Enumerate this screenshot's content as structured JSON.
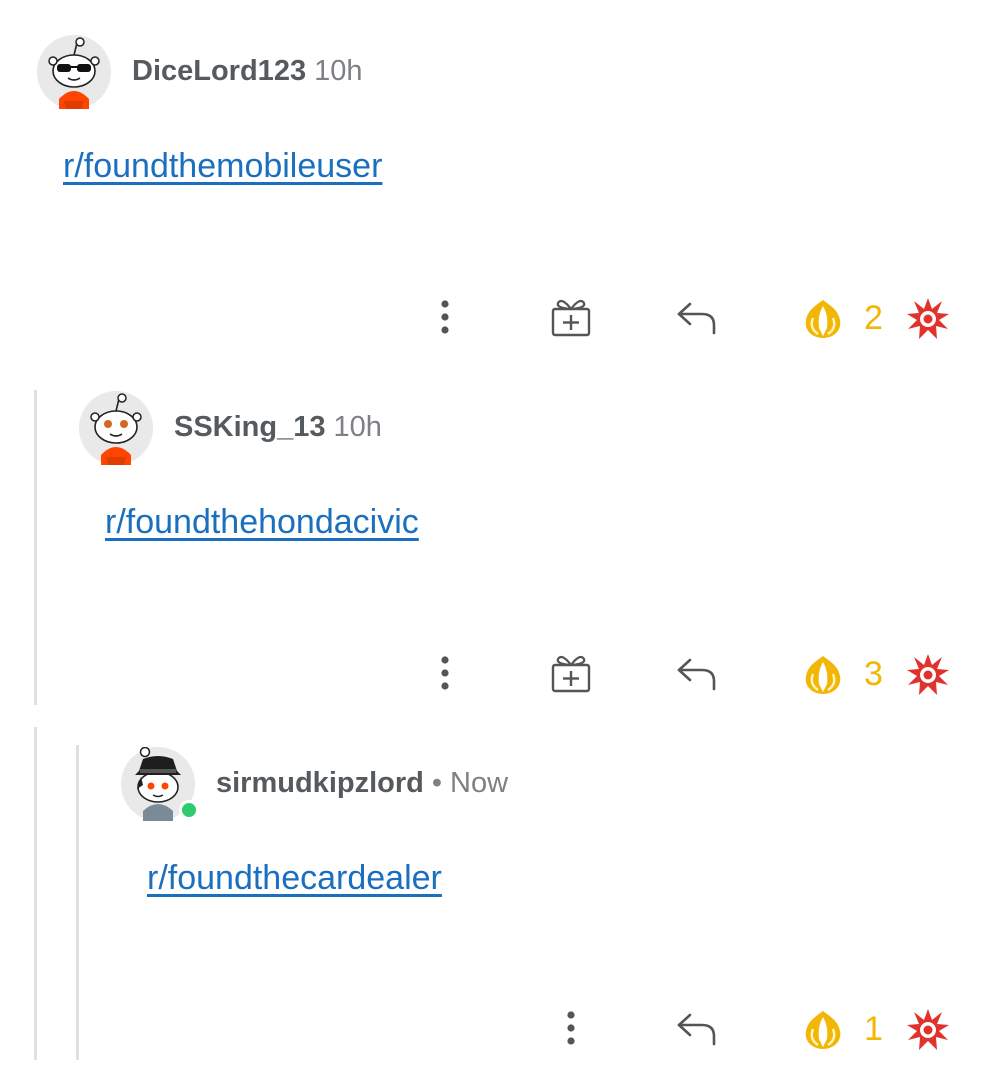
{
  "colors": {
    "link": "#1a6fbf",
    "username": "#555a5e",
    "meta": "#7d8084",
    "upvote": "#f2b705",
    "downvote": "#e0332e",
    "online": "#2ecc71",
    "thread_line": "#e0e0e0"
  },
  "comments": [
    {
      "username": "DiceLord123",
      "time": "10h",
      "separator": "",
      "body": "r/foundthemobileuser",
      "vote_count": "2",
      "avatar": "snoo-sunglasses-avatar",
      "actions": [
        "more-icon",
        "gift-icon",
        "reply-icon",
        "upvote-icon",
        "downvote-icon"
      ]
    },
    {
      "username": "SSKing_13",
      "time": "10h",
      "separator": "",
      "body": "r/foundthehondacivic",
      "vote_count": "3",
      "avatar": "snoo-default-avatar",
      "actions": [
        "more-icon",
        "gift-icon",
        "reply-icon",
        "upvote-icon",
        "downvote-icon"
      ]
    },
    {
      "username": "sirmudkipzlord",
      "time": "Now",
      "separator": "•",
      "body": "r/foundthecardealer",
      "vote_count": "1",
      "avatar": "snoo-hat-avatar",
      "online": true,
      "actions": [
        "more-icon",
        "reply-icon",
        "upvote-icon",
        "downvote-icon"
      ]
    }
  ]
}
